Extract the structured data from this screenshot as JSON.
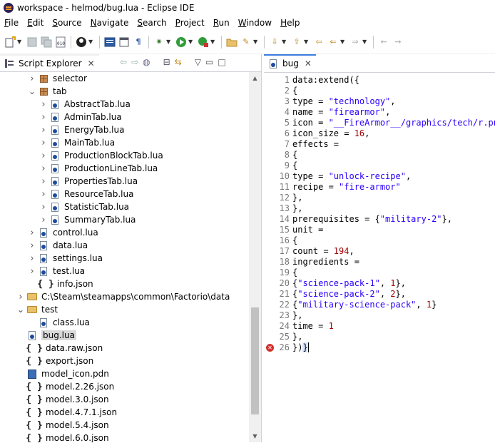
{
  "window": {
    "title": "workspace - helmod/bug.lua - Eclipse IDE"
  },
  "menu": [
    {
      "m": "F",
      "r": "ile"
    },
    {
      "m": "E",
      "r": "dit"
    },
    {
      "m": "S",
      "r": "ource"
    },
    {
      "m": "N",
      "r": "avigate"
    },
    {
      "m": "S",
      "r": "earch"
    },
    {
      "m": "P",
      "r": "roject"
    },
    {
      "m": "R",
      "r": "un"
    },
    {
      "m": "W",
      "r": "indow"
    },
    {
      "m": "H",
      "r": "elp"
    }
  ],
  "explorer": {
    "tab_label": "Script Explorer",
    "tree": [
      {
        "label": "selector",
        "type": "package",
        "indent": 2,
        "twisty": "collapsed"
      },
      {
        "label": "tab",
        "type": "package",
        "indent": 2,
        "twisty": "expanded"
      },
      {
        "label": "AbstractTab.lua",
        "type": "lua",
        "indent": 3,
        "twisty": "collapsed"
      },
      {
        "label": "AdminTab.lua",
        "type": "lua",
        "indent": 3,
        "twisty": "collapsed"
      },
      {
        "label": "EnergyTab.lua",
        "type": "lua",
        "indent": 3,
        "twisty": "collapsed"
      },
      {
        "label": "MainTab.lua",
        "type": "lua",
        "indent": 3,
        "twisty": "collapsed"
      },
      {
        "label": "ProductionBlockTab.lua",
        "type": "lua",
        "indent": 3,
        "twisty": "collapsed"
      },
      {
        "label": "ProductionLineTab.lua",
        "type": "lua",
        "indent": 3,
        "twisty": "collapsed"
      },
      {
        "label": "PropertiesTab.lua",
        "type": "lua",
        "indent": 3,
        "twisty": "collapsed"
      },
      {
        "label": "ResourceTab.lua",
        "type": "lua",
        "indent": 3,
        "twisty": "collapsed"
      },
      {
        "label": "StatisticTab.lua",
        "type": "lua",
        "indent": 3,
        "twisty": "collapsed"
      },
      {
        "label": "SummaryTab.lua",
        "type": "lua",
        "indent": 3,
        "twisty": "collapsed"
      },
      {
        "label": "control.lua",
        "type": "lua",
        "indent": 2,
        "twisty": "collapsed"
      },
      {
        "label": "data.lua",
        "type": "lua",
        "indent": 2,
        "twisty": "collapsed"
      },
      {
        "label": "settings.lua",
        "type": "lua",
        "indent": 2,
        "twisty": "collapsed"
      },
      {
        "label": "test.lua",
        "type": "lua",
        "indent": 2,
        "twisty": "collapsed"
      },
      {
        "label": "info.json",
        "type": "json",
        "indent": 2,
        "twisty": ""
      },
      {
        "label": "C:\\Steam\\steamapps\\common\\Factorio\\data",
        "type": "folder",
        "indent": 1,
        "twisty": "collapsed"
      },
      {
        "label": "test",
        "type": "folder",
        "indent": 1,
        "twisty": "expanded"
      },
      {
        "label": "class.lua",
        "type": "lua",
        "indent": 2,
        "twisty": ""
      },
      {
        "label": "bug.lua",
        "type": "lua",
        "indent": 1,
        "twisty": "",
        "selected": true
      },
      {
        "label": "data.raw.json",
        "type": "json",
        "indent": 1,
        "twisty": ""
      },
      {
        "label": "export.json",
        "type": "json",
        "indent": 1,
        "twisty": ""
      },
      {
        "label": "model_icon.pdn",
        "type": "pdn",
        "indent": 1,
        "twisty": ""
      },
      {
        "label": "model.2.26.json",
        "type": "json",
        "indent": 1,
        "twisty": ""
      },
      {
        "label": "model.3.0.json",
        "type": "json",
        "indent": 1,
        "twisty": ""
      },
      {
        "label": "model.4.7.1.json",
        "type": "json",
        "indent": 1,
        "twisty": ""
      },
      {
        "label": "model.5.4.json",
        "type": "json",
        "indent": 1,
        "twisty": ""
      },
      {
        "label": "model.6.0.json",
        "type": "json",
        "indent": 1,
        "twisty": ""
      }
    ]
  },
  "editor": {
    "tab_label": "bug",
    "lines": [
      [
        {
          "t": "data:extend({"
        }
      ],
      [
        {
          "t": "{"
        }
      ],
      [
        {
          "t": "type = "
        },
        {
          "t": "\"technology\"",
          "c": "str"
        },
        {
          "t": ","
        }
      ],
      [
        {
          "t": "name = "
        },
        {
          "t": "\"firearmor\"",
          "c": "str"
        },
        {
          "t": ","
        }
      ],
      [
        {
          "t": "icon = "
        },
        {
          "t": "\"__FireArmor__/graphics/tech/r.png\"",
          "c": "str"
        },
        {
          "t": ","
        }
      ],
      [
        {
          "t": "icon_size = "
        },
        {
          "t": "16",
          "c": "num"
        },
        {
          "t": ","
        }
      ],
      [
        {
          "t": "effects ="
        }
      ],
      [
        {
          "t": "{"
        }
      ],
      [
        {
          "t": "{"
        }
      ],
      [
        {
          "t": "type = "
        },
        {
          "t": "\"unlock-recipe\"",
          "c": "str"
        },
        {
          "t": ","
        }
      ],
      [
        {
          "t": "recipe = "
        },
        {
          "t": "\"fire-armor\"",
          "c": "str"
        }
      ],
      [
        {
          "t": "},"
        }
      ],
      [
        {
          "t": "},"
        }
      ],
      [
        {
          "t": "prerequisites = {"
        },
        {
          "t": "\"military-2\"",
          "c": "str"
        },
        {
          "t": "},"
        }
      ],
      [
        {
          "t": "unit ="
        }
      ],
      [
        {
          "t": "{"
        }
      ],
      [
        {
          "t": "count = "
        },
        {
          "t": "194",
          "c": "num"
        },
        {
          "t": ","
        }
      ],
      [
        {
          "t": "ingredients ="
        }
      ],
      [
        {
          "t": "{"
        }
      ],
      [
        {
          "t": "{"
        },
        {
          "t": "\"science-pack-1\"",
          "c": "str"
        },
        {
          "t": ", "
        },
        {
          "t": "1",
          "c": "num"
        },
        {
          "t": "},"
        }
      ],
      [
        {
          "t": "{"
        },
        {
          "t": "\"science-pack-2\"",
          "c": "str"
        },
        {
          "t": ", "
        },
        {
          "t": "2",
          "c": "num"
        },
        {
          "t": "},"
        }
      ],
      [
        {
          "t": "{"
        },
        {
          "t": "\"military-science-pack\"",
          "c": "str"
        },
        {
          "t": ", "
        },
        {
          "t": "1",
          "c": "num"
        },
        {
          "t": "}"
        }
      ],
      [
        {
          "t": "},"
        }
      ],
      [
        {
          "t": "time = "
        },
        {
          "t": "1",
          "c": "num"
        }
      ],
      [
        {
          "t": "},"
        }
      ],
      [
        {
          "t": "})"
        },
        {
          "t": "}",
          "c": "caret"
        }
      ]
    ],
    "error_line": 26
  }
}
